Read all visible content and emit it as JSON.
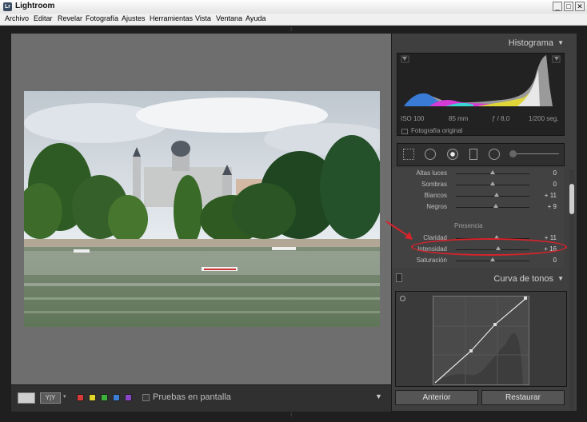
{
  "window": {
    "title": "Lightroom",
    "icon_text": "Lr",
    "buttons": [
      "_",
      "□",
      "✕"
    ]
  },
  "menu": [
    "Archivo",
    "Editar",
    "Revelar",
    "Fotografía",
    "Ajustes",
    "Herramientas",
    "Vista",
    "Ventana",
    "Ayuda"
  ],
  "histogram": {
    "title": "Histograma",
    "iso": "ISO 100",
    "focal": "85 mm",
    "aperture": "ƒ / 8,0",
    "shutter": "1/200 seg.",
    "original_label": "Fotografía original"
  },
  "basic": {
    "tone_rows": [
      {
        "label": "Altas luces",
        "value": "0",
        "level": 0.5
      },
      {
        "label": "Sombras",
        "value": "0",
        "level": 0.5
      },
      {
        "label": "Blancos",
        "value": "+ 11",
        "level": 0.555
      },
      {
        "label": "Negros",
        "value": "+ 9",
        "level": 0.545
      }
    ],
    "presence_label": "Presencia",
    "presence_rows": [
      {
        "label": "Claridad",
        "value": "+ 11",
        "level": 0.555
      },
      {
        "label": "Intensidad",
        "value": "+ 16",
        "level": 0.58
      },
      {
        "label": "Saturación",
        "value": "0",
        "level": 0.5
      }
    ]
  },
  "curve": {
    "title": "Curva de tonos"
  },
  "buttons": {
    "previous": "Anterior",
    "reset": "Restaurar"
  },
  "toolbar": {
    "view_label": "Y|Y",
    "softproof_label": "Pruebas en pantalla",
    "color_labels": [
      "#d83a3a",
      "#e2d52a",
      "#3bb33b",
      "#3d7fd6",
      "#8a46c7"
    ]
  },
  "annotation": {
    "color": "#d8232a"
  }
}
